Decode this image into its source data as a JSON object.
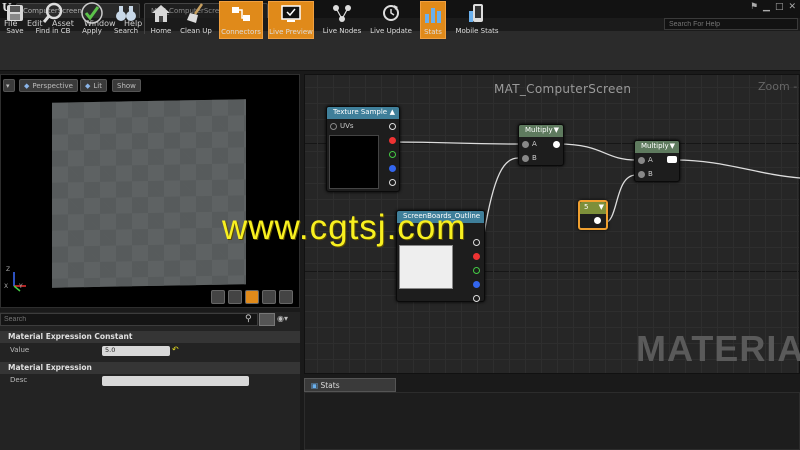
{
  "tabs": [
    {
      "label": "ComputerScreen"
    },
    {
      "label": "MAT_ComputerScreen"
    }
  ],
  "menu": [
    "File",
    "Edit",
    "Asset",
    "Window",
    "Help"
  ],
  "search_help": {
    "placeholder": "Search For Help"
  },
  "toolbar": [
    {
      "label": "Save",
      "icon": "save-icon",
      "active": false
    },
    {
      "label": "Find in CB",
      "icon": "magnifier-icon",
      "active": false
    },
    {
      "label": "Apply",
      "icon": "checkmark-icon",
      "active": false
    },
    {
      "label": "Search",
      "icon": "binoculars-icon",
      "active": false
    },
    {
      "label": "Home",
      "icon": "home-icon",
      "active": false
    },
    {
      "label": "Clean Up",
      "icon": "broom-icon",
      "active": false
    },
    {
      "label": "Connectors",
      "icon": "connectors-icon",
      "active": true
    },
    {
      "label": "Live Preview",
      "icon": "monitor-icon",
      "active": true
    },
    {
      "label": "Live Nodes",
      "icon": "nodes-icon",
      "active": false
    },
    {
      "label": "Live Update",
      "icon": "refresh-icon",
      "active": false
    },
    {
      "label": "Stats",
      "icon": "bars-icon",
      "active": true
    },
    {
      "label": "Mobile Stats",
      "icon": "mobile-icon",
      "active": false
    }
  ],
  "viewport": {
    "perspective": "Perspective",
    "lit": "Lit",
    "show": "Show",
    "axis_z": "Z",
    "axis_x": "X",
    "axis_y": "Y"
  },
  "details": {
    "search_placeholder": "Search",
    "section1": "Material Expression Constant",
    "value_label": "Value",
    "value": "5.0",
    "section2": "Material Expression",
    "desc_label": "Desc"
  },
  "graph": {
    "title": "MAT_ComputerScreen",
    "zoom": "Zoom -",
    "watermark": "MATERIAL",
    "nodes": {
      "texture_sample": {
        "title": "Texture Sample",
        "input": "UVs"
      },
      "screen_boards": {
        "title": "ScreenBoards_Outline"
      },
      "multiply1": {
        "title": "Multiply",
        "a": "A",
        "b": "B"
      },
      "multiply2": {
        "title": "Multiply",
        "a": "A",
        "b": "B"
      },
      "constant": {
        "title": "5"
      }
    }
  },
  "stats_tab": "Stats",
  "watermark_site": "www.cgtsj.com",
  "colors": {
    "accent": "#e08a1a",
    "node_texture": "#3f7f9a",
    "node_math": "#5e7a5e",
    "node_constant": "#7d8f3a",
    "selected": "#f0a030"
  }
}
